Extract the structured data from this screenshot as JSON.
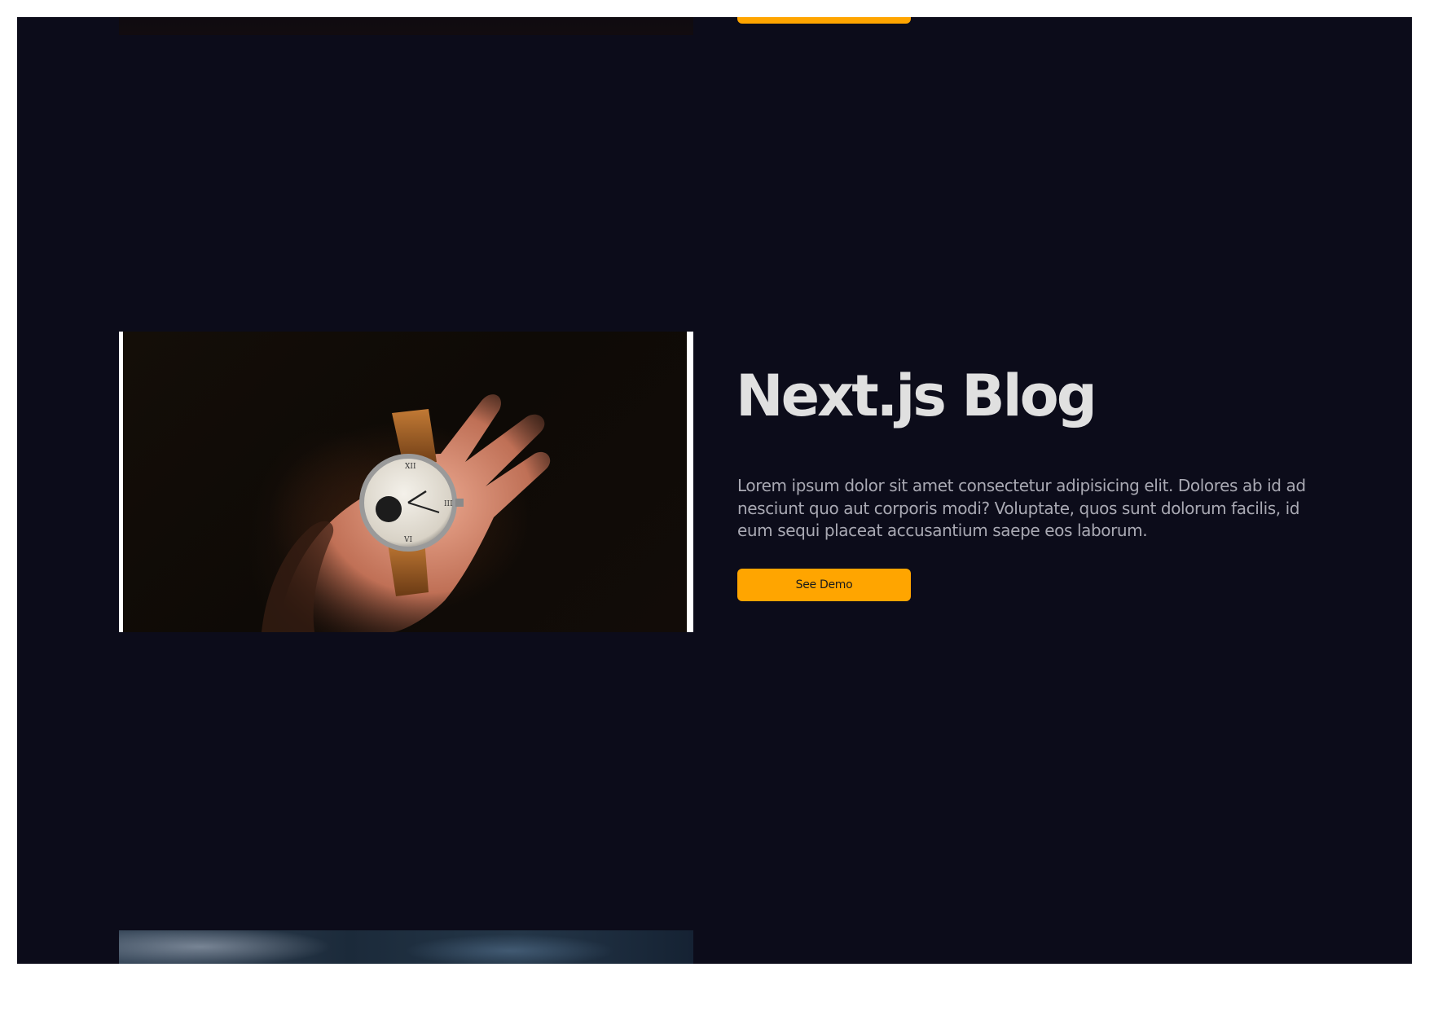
{
  "projects": [
    {
      "button_label": ""
    },
    {
      "title": "Next.js Blog",
      "description": "Lorem ipsum dolor sit amet consectetur adipisicing elit. Dolores ab id ad nesciunt quo aut corporis modi? Voluptate, quos sunt dolorum facilis, id eum sequi placeat accusantium saepe eos laborum.",
      "button_label": "See Demo",
      "image_subject": "hand-holding-wristwatch"
    },
    {
      "image_subject": "cloudy-sky"
    }
  ],
  "colors": {
    "background": "#0c0c1a",
    "accent": "#ffa500",
    "title": "#e0e0e0",
    "body_text": "#a9a9b3"
  }
}
